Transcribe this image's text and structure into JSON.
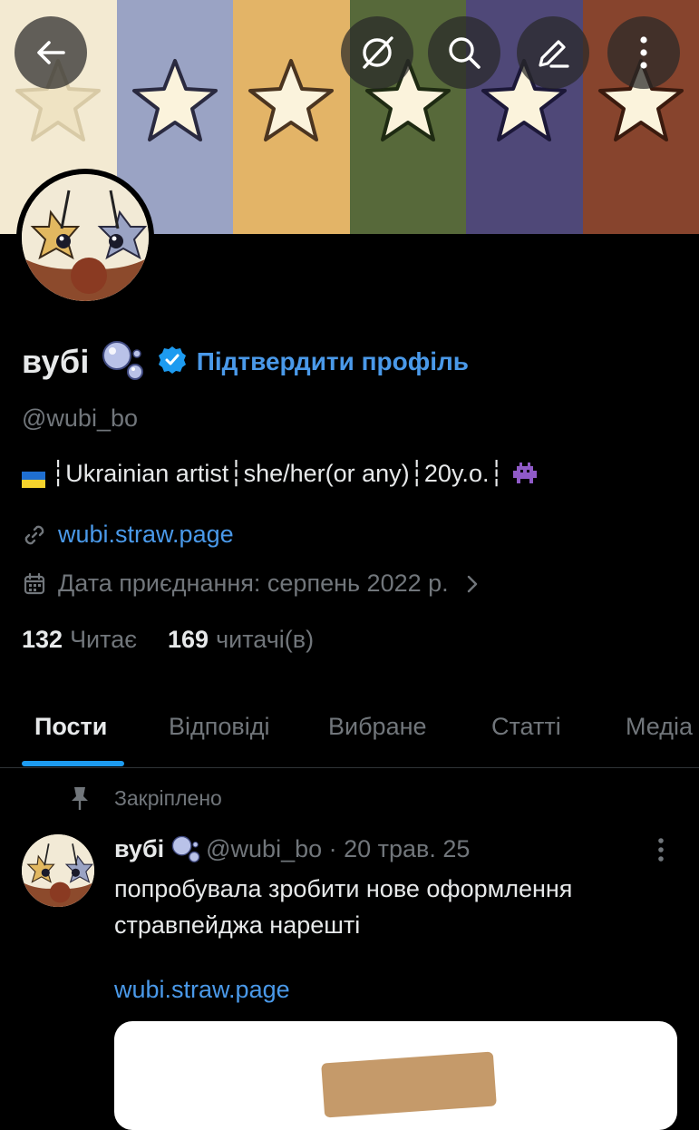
{
  "banner": {
    "stripe_colors": [
      "#f3ead2",
      "#9aa3c4",
      "#e3b467",
      "#57693a",
      "#4f4878",
      "#87442d"
    ]
  },
  "profile": {
    "display_name": "вубі",
    "verify_link": "Підтвердити профіль",
    "handle": "@wubi_bo",
    "bio": "┆Ukrainian artist┆she/her(or any)┆20y.o.┆",
    "website": "wubi.straw.page",
    "joined": "Дата приєднання: серпень 2022 р.",
    "following_count": "132",
    "following_label": "Читає",
    "followers_count": "169",
    "followers_label": "читачі(в)"
  },
  "tabs": [
    {
      "label": "Пости",
      "active": true
    },
    {
      "label": "Відповіді",
      "active": false
    },
    {
      "label": "Вибране",
      "active": false
    },
    {
      "label": "Статті",
      "active": false
    },
    {
      "label": "Медіа",
      "active": false
    }
  ],
  "post": {
    "pinned_label": "Закріплено",
    "author": "вубі",
    "handle_date": "@wubi_bo · 20 трав. 25",
    "text": "попробувала зробити нове оформлення стравпейджа нарешті",
    "link": "wubi.straw.page"
  },
  "icons": {
    "back": "arrow-left-icon",
    "grok": "grok-icon",
    "search": "search-icon",
    "edit": "pencil-icon",
    "more": "more-vertical-icon",
    "verified": "verified-badge-icon",
    "link": "link-icon",
    "calendar": "calendar-icon",
    "pin": "pin-icon"
  },
  "colors": {
    "accent": "#1d9bf0",
    "link": "#4a99e9",
    "muted": "#71767b",
    "background": "#000000"
  }
}
